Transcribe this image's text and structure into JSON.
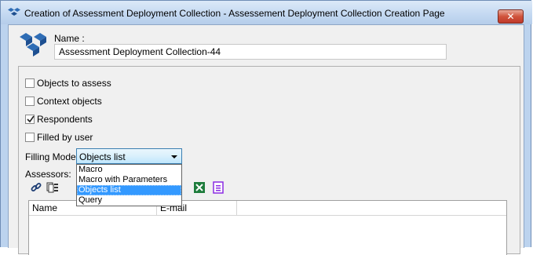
{
  "window": {
    "title": "Creation of Assessment Deployment Collection - Assessement Deployment Collection Creation Page",
    "close_label": "✕",
    "icon": "cubes-icon"
  },
  "name_section": {
    "label": "Name :",
    "value": "Assessment Deployment Collection-44"
  },
  "checkboxes": [
    {
      "label": "Objects to assess",
      "checked": false
    },
    {
      "label": "Context objects",
      "checked": false
    },
    {
      "label": "Respondents",
      "checked": true
    },
    {
      "label": "Filled by user",
      "checked": false
    }
  ],
  "filling_mode": {
    "label": "Filling Mode:",
    "selected": "Objects list",
    "options": [
      "Macro",
      "Macro with Parameters",
      "Objects list",
      "Query"
    ],
    "highlighted_index": 2
  },
  "assessors": {
    "label": "Assessors:",
    "toolbar_icons": [
      "link-icon",
      "list-icon",
      "excel-icon",
      "report-icon"
    ]
  },
  "table": {
    "columns": [
      "Name",
      "E-mail"
    ]
  },
  "colors": {
    "accent": "#3399ff",
    "title_bar": "#c3d8f1",
    "close": "#c0392b"
  }
}
